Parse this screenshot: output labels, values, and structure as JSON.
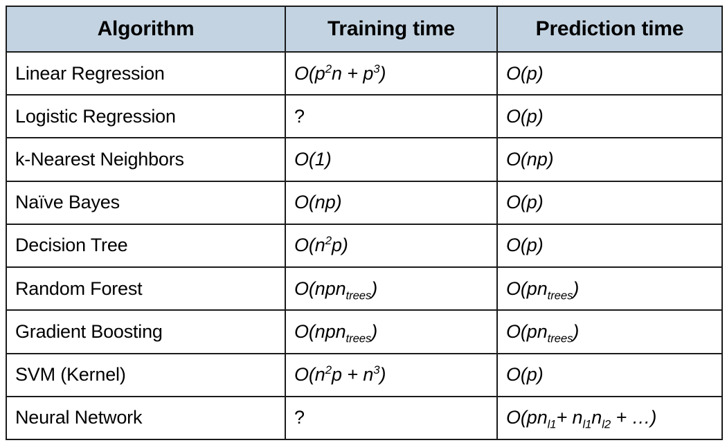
{
  "table": {
    "name": "ml-algorithm-complexity-table",
    "header_background": "#c3d3e1",
    "border_color": "#1a1a1a",
    "columns": [
      {
        "key": "algorithm",
        "label": "Algorithm"
      },
      {
        "key": "training",
        "label": "Training time"
      },
      {
        "key": "prediction",
        "label": "Prediction time"
      }
    ],
    "rows": [
      {
        "algorithm": "Linear Regression",
        "training_text": "O(p2n + p3)",
        "training_parts": [
          {
            "t": "O(",
            "s": "plain"
          },
          {
            "t": "p",
            "s": "var"
          },
          {
            "t": "2",
            "s": "sup"
          },
          {
            "t": "n",
            "s": "var"
          },
          {
            "t": " + ",
            "s": "plain"
          },
          {
            "t": "p",
            "s": "var"
          },
          {
            "t": "3",
            "s": "sup"
          },
          {
            "t": ")",
            "s": "plain"
          }
        ],
        "prediction_text": "O(p)",
        "prediction_parts": [
          {
            "t": "O(",
            "s": "plain"
          },
          {
            "t": "p",
            "s": "var"
          },
          {
            "t": ")",
            "s": "plain"
          }
        ]
      },
      {
        "algorithm": "Logistic Regression",
        "training_text": "?",
        "training_parts": [
          {
            "t": "?",
            "s": "q"
          }
        ],
        "prediction_text": "O(p)",
        "prediction_parts": [
          {
            "t": "O(",
            "s": "plain"
          },
          {
            "t": "p",
            "s": "var"
          },
          {
            "t": ")",
            "s": "plain"
          }
        ]
      },
      {
        "algorithm": "k-Nearest Neighbors",
        "training_text": "O(1)",
        "training_parts": [
          {
            "t": "O(1)",
            "s": "plain"
          }
        ],
        "prediction_text": "O(np)",
        "prediction_parts": [
          {
            "t": "O(",
            "s": "plain"
          },
          {
            "t": "np",
            "s": "var"
          },
          {
            "t": ")",
            "s": "plain"
          }
        ]
      },
      {
        "algorithm": "Naïve Bayes",
        "training_text": "O(np)",
        "training_parts": [
          {
            "t": "O(",
            "s": "plain"
          },
          {
            "t": "np",
            "s": "var"
          },
          {
            "t": ")",
            "s": "plain"
          }
        ],
        "prediction_text": "O(p)",
        "prediction_parts": [
          {
            "t": "O(",
            "s": "plain"
          },
          {
            "t": "p",
            "s": "var"
          },
          {
            "t": ")",
            "s": "plain"
          }
        ]
      },
      {
        "algorithm": "Decision Tree",
        "training_text": "O(n2p)",
        "training_parts": [
          {
            "t": "O(",
            "s": "plain"
          },
          {
            "t": "n",
            "s": "var"
          },
          {
            "t": "2",
            "s": "sup"
          },
          {
            "t": "p",
            "s": "var"
          },
          {
            "t": ")",
            "s": "plain"
          }
        ],
        "prediction_text": "O(p)",
        "prediction_parts": [
          {
            "t": "O(",
            "s": "plain"
          },
          {
            "t": "p",
            "s": "var"
          },
          {
            "t": ")",
            "s": "plain"
          }
        ]
      },
      {
        "algorithm": "Random Forest",
        "training_text": "O(npntrees)",
        "training_parts": [
          {
            "t": "O(",
            "s": "plain"
          },
          {
            "t": "npn",
            "s": "var"
          },
          {
            "t": "trees",
            "s": "sub"
          },
          {
            "t": ")",
            "s": "plain"
          }
        ],
        "prediction_text": "O(pntrees)",
        "prediction_parts": [
          {
            "t": "O(",
            "s": "plain"
          },
          {
            "t": "pn",
            "s": "var"
          },
          {
            "t": "trees",
            "s": "sub"
          },
          {
            "t": ")",
            "s": "plain"
          }
        ]
      },
      {
        "algorithm": "Gradient Boosting",
        "training_text": "O(npntrees)",
        "training_parts": [
          {
            "t": "O(",
            "s": "plain"
          },
          {
            "t": "npn",
            "s": "var"
          },
          {
            "t": "trees",
            "s": "sub"
          },
          {
            "t": ")",
            "s": "plain"
          }
        ],
        "prediction_text": "O(pntrees)",
        "prediction_parts": [
          {
            "t": "O(",
            "s": "plain"
          },
          {
            "t": "pn",
            "s": "var"
          },
          {
            "t": "trees",
            "s": "sub"
          },
          {
            "t": ")",
            "s": "plain"
          }
        ]
      },
      {
        "algorithm": "SVM (Kernel)",
        "training_text": "O(n2p + n3)",
        "training_parts": [
          {
            "t": "O(",
            "s": "plain"
          },
          {
            "t": "n",
            "s": "var"
          },
          {
            "t": "2",
            "s": "sup"
          },
          {
            "t": "p",
            "s": "var"
          },
          {
            "t": " + ",
            "s": "plain"
          },
          {
            "t": "n",
            "s": "var"
          },
          {
            "t": "3",
            "s": "sup"
          },
          {
            "t": ")",
            "s": "plain"
          }
        ],
        "prediction_text": "O(p)",
        "prediction_parts": [
          {
            "t": "O(",
            "s": "plain"
          },
          {
            "t": "p",
            "s": "var"
          },
          {
            "t": ")",
            "s": "plain"
          }
        ]
      },
      {
        "algorithm": "Neural Network",
        "training_text": "?",
        "training_parts": [
          {
            "t": "?",
            "s": "q"
          }
        ],
        "prediction_text": "O(pnl1+ nl1nl2 + …)",
        "prediction_parts": [
          {
            "t": "O(",
            "s": "plain"
          },
          {
            "t": "pn",
            "s": "var"
          },
          {
            "t": "l1",
            "s": "sub"
          },
          {
            "t": "+ ",
            "s": "plain"
          },
          {
            "t": "n",
            "s": "var"
          },
          {
            "t": "l1",
            "s": "sub"
          },
          {
            "t": "n",
            "s": "var"
          },
          {
            "t": "l2",
            "s": "sub"
          },
          {
            "t": " + …)",
            "s": "plain"
          }
        ]
      }
    ]
  }
}
